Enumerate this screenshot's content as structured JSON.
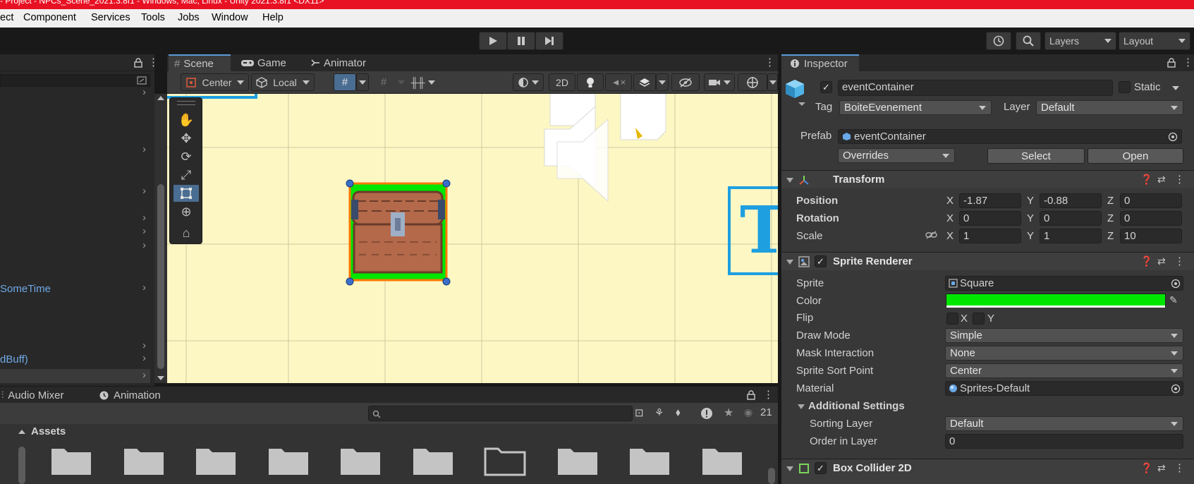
{
  "title_bar": {
    "text": "- Project - NPCs_Scene_2021.3.8f1 - Windows, Mac, Linux - Unity 2021.3.8f1 <DX11>"
  },
  "menu": [
    "ect",
    "Component",
    "Services",
    "Tools",
    "Jobs",
    "Window",
    "Help"
  ],
  "toolbar": {
    "layers": "Layers",
    "layout": "Layout"
  },
  "hierarchy": {
    "items": [
      {
        "label": "SomeTime"
      },
      {
        "label": "dBuff)"
      }
    ]
  },
  "scene": {
    "tabs": [
      "Scene",
      "Game",
      "Animator"
    ],
    "pivot": "Center",
    "space": "Local",
    "mode_2d": "2D",
    "gizmo_letter": "T"
  },
  "bottom": {
    "tabs": [
      "Audio Mixer",
      "Animation"
    ],
    "hidden_count": "21",
    "assets_label": "Assets",
    "folder_count": 10
  },
  "inspector": {
    "tab": "Inspector",
    "object_name": "eventContainer",
    "static_label": "Static",
    "tag_label": "Tag",
    "tag_value": "BoiteEvenement",
    "layer_label": "Layer",
    "layer_value": "Default",
    "prefab_label": "Prefab",
    "prefab_value": "eventContainer",
    "overrides": "Overrides",
    "select": "Select",
    "open": "Open",
    "transform": {
      "title": "Transform",
      "position_label": "Position",
      "rotation_label": "Rotation",
      "scale_label": "Scale",
      "position": {
        "x": "-1.87",
        "y": "-0.88",
        "z": "0"
      },
      "rotation": {
        "x": "0",
        "y": "0",
        "z": "0"
      },
      "scale": {
        "x": "1",
        "y": "1",
        "z": "10"
      }
    },
    "sprite_renderer": {
      "title": "Sprite Renderer",
      "sprite_label": "Sprite",
      "sprite_value": "Square",
      "color_label": "Color",
      "color_value": "#00e600",
      "flip_label": "Flip",
      "flip_x": "X",
      "flip_y": "Y",
      "draw_mode_label": "Draw Mode",
      "draw_mode_value": "Simple",
      "mask_label": "Mask Interaction",
      "mask_value": "None",
      "sort_point_label": "Sprite Sort Point",
      "sort_point_value": "Center",
      "material_label": "Material",
      "material_value": "Sprites-Default",
      "additional": "Additional Settings",
      "sorting_layer_label": "Sorting Layer",
      "sorting_layer_value": "Default",
      "order_label": "Order in Layer",
      "order_value": "0"
    },
    "box_collider": {
      "title": "Box Collider 2D"
    }
  },
  "colors": {
    "accent": "#5b9ad9",
    "title_bar": "#e81123",
    "viewport_bg": "#fdf7c4",
    "selection_green": "#00e600",
    "gizmo_blue": "#1e9fe0"
  }
}
